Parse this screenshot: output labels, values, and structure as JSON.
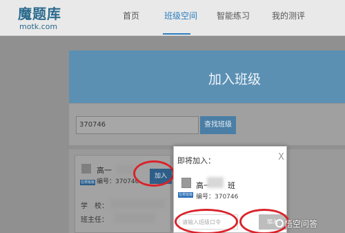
{
  "header": {
    "logo_cn": "魔题库",
    "logo_en": "motk.com",
    "nav": [
      {
        "label": "首页"
      },
      {
        "label": "班级空间"
      },
      {
        "label": "智能练习"
      },
      {
        "label": "我的测评"
      }
    ]
  },
  "banner": {
    "title": "加入班级"
  },
  "search": {
    "value": "370746",
    "button": "查找班级"
  },
  "class_card": {
    "badge": "在校班级",
    "name": "高一",
    "code": "编号：370746",
    "join_button": "加入",
    "school_label": "学　校：",
    "teacher_label": "班主任："
  },
  "modal": {
    "title": "即将加入：",
    "close": "X",
    "badge": "在校班级",
    "class_name": "高一",
    "class_suffix": "班",
    "code": "编号：370746",
    "input_placeholder": "请输入班级口令",
    "join_button": "加入"
  },
  "watermark": {
    "text": "悟空问答"
  },
  "colors": {
    "accent_blue": "#2f8fd0",
    "annotation_red": "#d9232b"
  }
}
